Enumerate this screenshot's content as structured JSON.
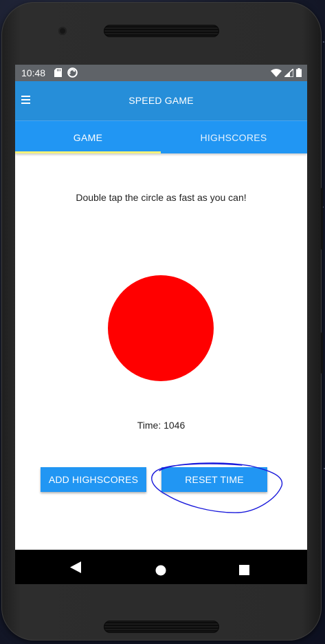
{
  "status_bar": {
    "time": "10:48"
  },
  "app_bar": {
    "title": "SPEED GAME",
    "menu_icon": "hamburger-menu-icon"
  },
  "tabs": [
    {
      "label": "GAME",
      "selected": true
    },
    {
      "label": "HIGHSCORES",
      "selected": false
    }
  ],
  "game": {
    "instruction": "Double tap the circle as fast as you can!",
    "circle_color": "#ff0000",
    "time_label": "Time: 1046"
  },
  "buttons": {
    "add_highscores": "ADD HIGHSCORES",
    "reset_time": "RESET TIME"
  },
  "nav": {
    "back": "back-icon",
    "home": "home-icon",
    "recents": "recents-icon"
  },
  "colors": {
    "app_bar": "#268ed9",
    "tab_bar": "#2196f3",
    "tab_indicator": "#f4f27a",
    "button": "#2196f3",
    "annotation_ink": "#1a1adb"
  }
}
